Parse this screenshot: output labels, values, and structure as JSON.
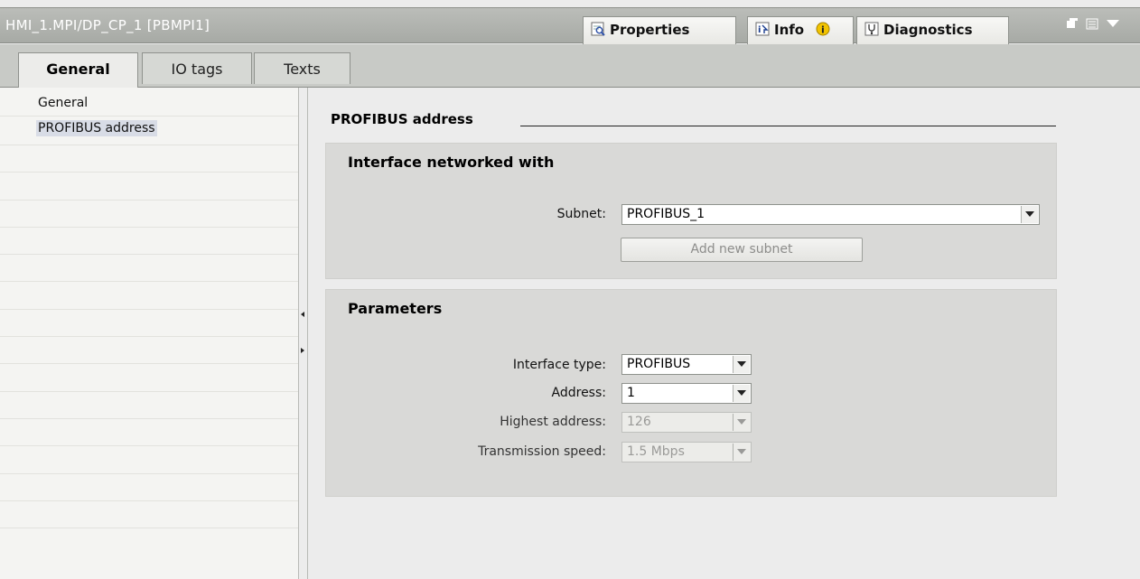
{
  "title_bar": {
    "title": "HMI_1.MPI/DP_CP_1 [PBMPI1]",
    "tabs": [
      {
        "label": "Properties",
        "icon": "properties-icon",
        "active": true
      },
      {
        "label": "Info",
        "icon": "info-icon",
        "badge_icon": "info-badge-icon"
      },
      {
        "label": "Diagnostics",
        "icon": "diagnostics-icon"
      }
    ]
  },
  "sub_tabs": [
    {
      "label": "General",
      "active": true
    },
    {
      "label": "IO tags",
      "active": false
    },
    {
      "label": "Texts",
      "active": false
    }
  ],
  "left_nav": {
    "items": [
      {
        "label": "General",
        "selected": false
      },
      {
        "label": "PROFIBUS address",
        "selected": true
      }
    ]
  },
  "content": {
    "section_title": "PROFIBUS address",
    "interface_panel": {
      "title": "Interface networked with",
      "subnet_label": "Subnet:",
      "subnet_value": "PROFIBUS_1",
      "add_subnet_button": "Add new subnet"
    },
    "parameters_panel": {
      "title": "Parameters",
      "interface_type_label": "Interface type:",
      "interface_type_value": "PROFIBUS",
      "address_label": "Address:",
      "address_value": "1",
      "highest_address_label": "Highest address:",
      "highest_address_value": "126",
      "transmission_speed_label": "Transmission speed:",
      "transmission_speed_value": "1.5 Mbps"
    }
  }
}
